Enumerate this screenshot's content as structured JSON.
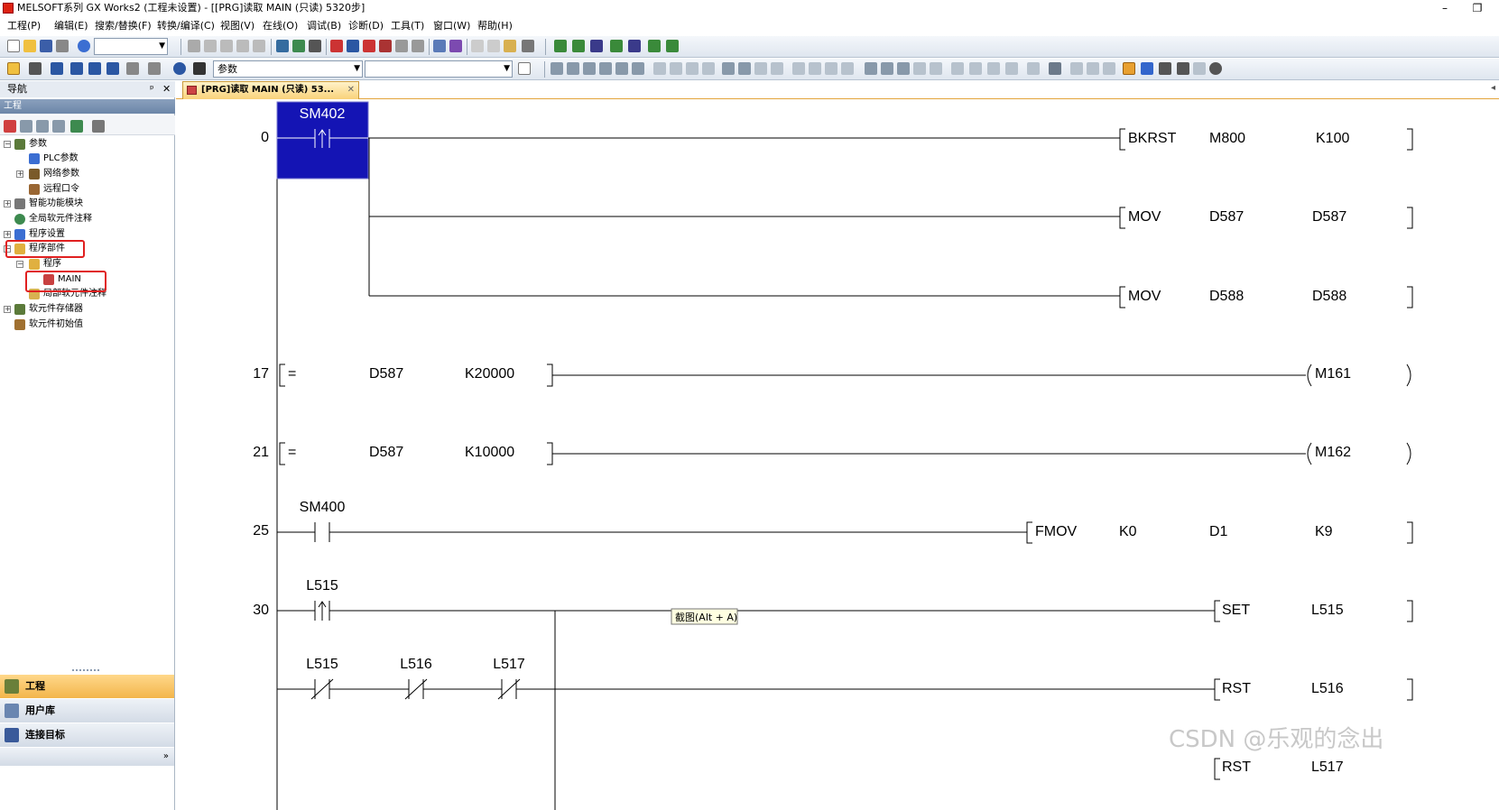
{
  "window": {
    "title": "MELSOFT系列 GX Works2 (工程未设置) - [[PRG]读取 MAIN (只读) 5320步]",
    "minimize": "–",
    "restore": "❐"
  },
  "menu": [
    "工程(P)",
    "编辑(E)",
    "搜索/替换(F)",
    "转换/编译(C)",
    "视图(V)",
    "在线(O)",
    "调试(B)",
    "诊断(D)",
    "工具(T)",
    "窗口(W)",
    "帮助(H)"
  ],
  "toolbar": {
    "combo_param": "参数"
  },
  "nav": {
    "header": "导航",
    "pin": "ᵖ",
    "close": "✕",
    "section": "工程",
    "tree": [
      {
        "label": "参数",
        "expander": "−"
      },
      {
        "label": "PLC参数",
        "expander": ""
      },
      {
        "label": "网络参数",
        "expander": "+"
      },
      {
        "label": "远程口令",
        "expander": ""
      },
      {
        "label": "智能功能模块",
        "expander": "+"
      },
      {
        "label": "全局软元件注释",
        "expander": ""
      },
      {
        "label": "程序设置",
        "expander": "+"
      },
      {
        "label": "程序部件",
        "expander": "−"
      },
      {
        "label": "程序",
        "expander": "−"
      },
      {
        "label": "MAIN",
        "expander": ""
      },
      {
        "label": "局部软元件注释",
        "expander": ""
      },
      {
        "label": "软元件存储器",
        "expander": "+"
      },
      {
        "label": "软元件初始值",
        "expander": ""
      }
    ],
    "panes": [
      "工程",
      "用户库",
      "连接目标"
    ],
    "more": "»"
  },
  "editor": {
    "tab_label": "[PRG]读取 MAIN (只读) 53...",
    "tab_close": "✕",
    "tab_scroll": "◂",
    "tooltip": "截图(Alt + A)",
    "watermark": "CSDN @乐观的念出"
  },
  "ladder": {
    "rungs": [
      {
        "step": "0",
        "contact": "SM402",
        "contact_type": "rising",
        "instructions": [
          {
            "op": "BKRST",
            "a": "M800",
            "b": "K100"
          },
          {
            "op": "MOV",
            "a": "D587",
            "b": "D587"
          },
          {
            "op": "MOV",
            "a": "D588",
            "b": "D588"
          }
        ]
      },
      {
        "step": "17",
        "compare": "=",
        "a": "D587",
        "b": "K20000",
        "coil": "M161"
      },
      {
        "step": "21",
        "compare": "=",
        "a": "D587",
        "b": "K10000",
        "coil": "M162"
      },
      {
        "step": "25",
        "contact": "SM400",
        "contact_type": "no",
        "instruction": {
          "op": "FMOV",
          "a": "K0",
          "b": "D1",
          "c": "K9"
        }
      },
      {
        "step": "30",
        "contact": "L515",
        "contact_type": "rising",
        "instruction": {
          "op": "SET",
          "a": "L515"
        }
      },
      {
        "contacts": [
          "L515",
          "L516",
          "L517"
        ],
        "contact_type": "nc",
        "instruction": {
          "op": "RST",
          "a": "L516"
        }
      },
      {
        "instruction": {
          "op": "RST",
          "a": "L517"
        }
      }
    ]
  }
}
